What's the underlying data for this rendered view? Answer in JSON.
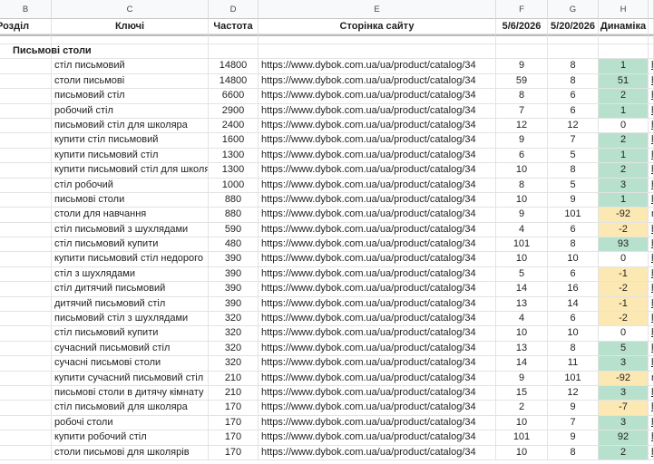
{
  "columns": [
    "B",
    "C",
    "D",
    "E",
    "F",
    "G",
    "H",
    ""
  ],
  "header": {
    "razdil": "Розділ",
    "keys": "Ключі",
    "freq": "Частота",
    "page": "Сторінка сайту",
    "date1": "5/6/2026",
    "date2": "5/20/2026",
    "dynamics": "Динаміка"
  },
  "section_title": "Письмові столи",
  "colors": {
    "positive": "#b7e1cd",
    "negative": "#fce8b2"
  },
  "rows": [
    {
      "key": "стіл письмовий",
      "freq": "14800",
      "url": "https://www.dybok.com.ua/ua/product/catalog/34",
      "p1": "9",
      "p2": "8",
      "dyn": "1",
      "extra": "h"
    },
    {
      "key": "столи письмові",
      "freq": "14800",
      "url": "https://www.dybok.com.ua/ua/product/catalog/34",
      "p1": "59",
      "p2": "8",
      "dyn": "51",
      "extra": "h"
    },
    {
      "key": "письмовий стіл",
      "freq": "6600",
      "url": "https://www.dybok.com.ua/ua/product/catalog/34",
      "p1": "8",
      "p2": "6",
      "dyn": "2",
      "extra": "h"
    },
    {
      "key": "робочий стіл",
      "freq": "2900",
      "url": "https://www.dybok.com.ua/ua/product/catalog/34",
      "p1": "7",
      "p2": "6",
      "dyn": "1",
      "extra": "h"
    },
    {
      "key": "письмовий стіл для школяра",
      "freq": "2400",
      "url": "https://www.dybok.com.ua/ua/product/catalog/34",
      "p1": "12",
      "p2": "12",
      "dyn": "0",
      "extra": "h"
    },
    {
      "key": "купити стіл письмовий",
      "freq": "1600",
      "url": "https://www.dybok.com.ua/ua/product/catalog/34",
      "p1": "9",
      "p2": "7",
      "dyn": "2",
      "extra": "h"
    },
    {
      "key": "купити письмовий стіл",
      "freq": "1300",
      "url": "https://www.dybok.com.ua/ua/product/catalog/34",
      "p1": "6",
      "p2": "5",
      "dyn": "1",
      "extra": "h"
    },
    {
      "key": "купити письмовий стіл для школяра",
      "freq": "1300",
      "url": "https://www.dybok.com.ua/ua/product/catalog/34",
      "p1": "10",
      "p2": "8",
      "dyn": "2",
      "extra": "h"
    },
    {
      "key": "стіл робочий",
      "freq": "1000",
      "url": "https://www.dybok.com.ua/ua/product/catalog/34",
      "p1": "8",
      "p2": "5",
      "dyn": "3",
      "extra": "h"
    },
    {
      "key": "письмові столи",
      "freq": "880",
      "url": "https://www.dybok.com.ua/ua/product/catalog/34",
      "p1": "10",
      "p2": "9",
      "dyn": "1",
      "extra": "h"
    },
    {
      "key": "столи для навчання",
      "freq": "880",
      "url": "https://www.dybok.com.ua/ua/product/catalog/34",
      "p1": "9",
      "p2": "101",
      "dyn": "-92",
      "extra": "n"
    },
    {
      "key": "стіл письмовий з шухлядами",
      "freq": "590",
      "url": "https://www.dybok.com.ua/ua/product/catalog/34",
      "p1": "4",
      "p2": "6",
      "dyn": "-2",
      "extra": "h"
    },
    {
      "key": "стіл письмовий купити",
      "freq": "480",
      "url": "https://www.dybok.com.ua/ua/product/catalog/34",
      "p1": "101",
      "p2": "8",
      "dyn": "93",
      "extra": "h"
    },
    {
      "key": "купити письмовий стіл недорого",
      "freq": "390",
      "url": "https://www.dybok.com.ua/ua/product/catalog/34",
      "p1": "10",
      "p2": "10",
      "dyn": "0",
      "extra": "h"
    },
    {
      "key": "стіл з шухлядами",
      "freq": "390",
      "url": "https://www.dybok.com.ua/ua/product/catalog/34",
      "p1": "5",
      "p2": "6",
      "dyn": "-1",
      "extra": "h"
    },
    {
      "key": "стіл дитячий письмовий",
      "freq": "390",
      "url": "https://www.dybok.com.ua/ua/product/catalog/34",
      "p1": "14",
      "p2": "16",
      "dyn": "-2",
      "extra": "h"
    },
    {
      "key": "дитячий письмовий стіл",
      "freq": "390",
      "url": "https://www.dybok.com.ua/ua/product/catalog/34",
      "p1": "13",
      "p2": "14",
      "dyn": "-1",
      "extra": "h"
    },
    {
      "key": "письмовий стіл з шухлядами",
      "freq": "320",
      "url": "https://www.dybok.com.ua/ua/product/catalog/34",
      "p1": "4",
      "p2": "6",
      "dyn": "-2",
      "extra": "h"
    },
    {
      "key": "стіл письмовий купити",
      "freq": "320",
      "url": "https://www.dybok.com.ua/ua/product/catalog/34",
      "p1": "10",
      "p2": "10",
      "dyn": "0",
      "extra": "h"
    },
    {
      "key": "сучасний письмовий стіл",
      "freq": "320",
      "url": "https://www.dybok.com.ua/ua/product/catalog/34",
      "p1": "13",
      "p2": "8",
      "dyn": "5",
      "extra": "h"
    },
    {
      "key": "сучасні письмові столи",
      "freq": "320",
      "url": "https://www.dybok.com.ua/ua/product/catalog/34",
      "p1": "14",
      "p2": "11",
      "dyn": "3",
      "extra": "h"
    },
    {
      "key": "купити сучасний письмовий стіл",
      "freq": "210",
      "url": "https://www.dybok.com.ua/ua/product/catalog/34",
      "p1": "9",
      "p2": "101",
      "dyn": "-92",
      "extra": "n"
    },
    {
      "key": "письмові столи в дитячу кімнату",
      "freq": "210",
      "url": "https://www.dybok.com.ua/ua/product/catalog/34",
      "p1": "15",
      "p2": "12",
      "dyn": "3",
      "extra": "h"
    },
    {
      "key": "стіл письмовий для школяра",
      "freq": "170",
      "url": "https://www.dybok.com.ua/ua/product/catalog/34",
      "p1": "2",
      "p2": "9",
      "dyn": "-7",
      "extra": "h"
    },
    {
      "key": "робочі столи",
      "freq": "170",
      "url": "https://www.dybok.com.ua/ua/product/catalog/34",
      "p1": "10",
      "p2": "7",
      "dyn": "3",
      "extra": "h"
    },
    {
      "key": "купити робочий стіл",
      "freq": "170",
      "url": "https://www.dybok.com.ua/ua/product/catalog/34",
      "p1": "101",
      "p2": "9",
      "dyn": "92",
      "extra": "h"
    },
    {
      "key": "столи письмові для школярів",
      "freq": "170",
      "url": "https://www.dybok.com.ua/ua/product/catalog/34",
      "p1": "10",
      "p2": "8",
      "dyn": "2",
      "extra": "h"
    }
  ]
}
